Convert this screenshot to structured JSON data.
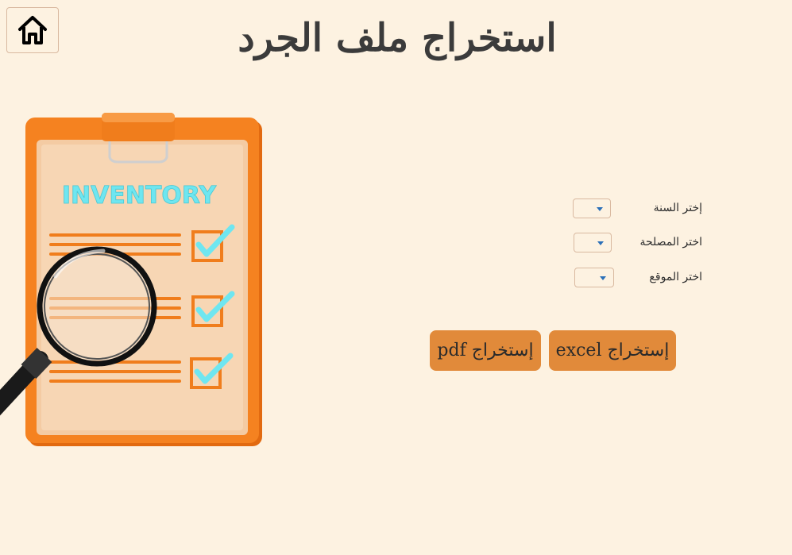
{
  "header": {
    "title": "استخراج ملف الجرد",
    "home_icon": "home-icon"
  },
  "illustration": {
    "label": "INVENTORY",
    "icon": "clipboard-magnifier-illustration"
  },
  "form": {
    "year": {
      "label": "إختر السنة",
      "value": ""
    },
    "department": {
      "label": "اختر المصلحة",
      "value": ""
    },
    "location": {
      "label": "اختر الموقع",
      "value": ""
    }
  },
  "actions": {
    "excel_label": "إستخراج excel",
    "pdf_label": "إستخراج pdf"
  },
  "colors": {
    "background": "#fdf2e1",
    "button": "#e18a3a",
    "clipboard": "#f07d1c",
    "text": "#3b3b3b"
  }
}
